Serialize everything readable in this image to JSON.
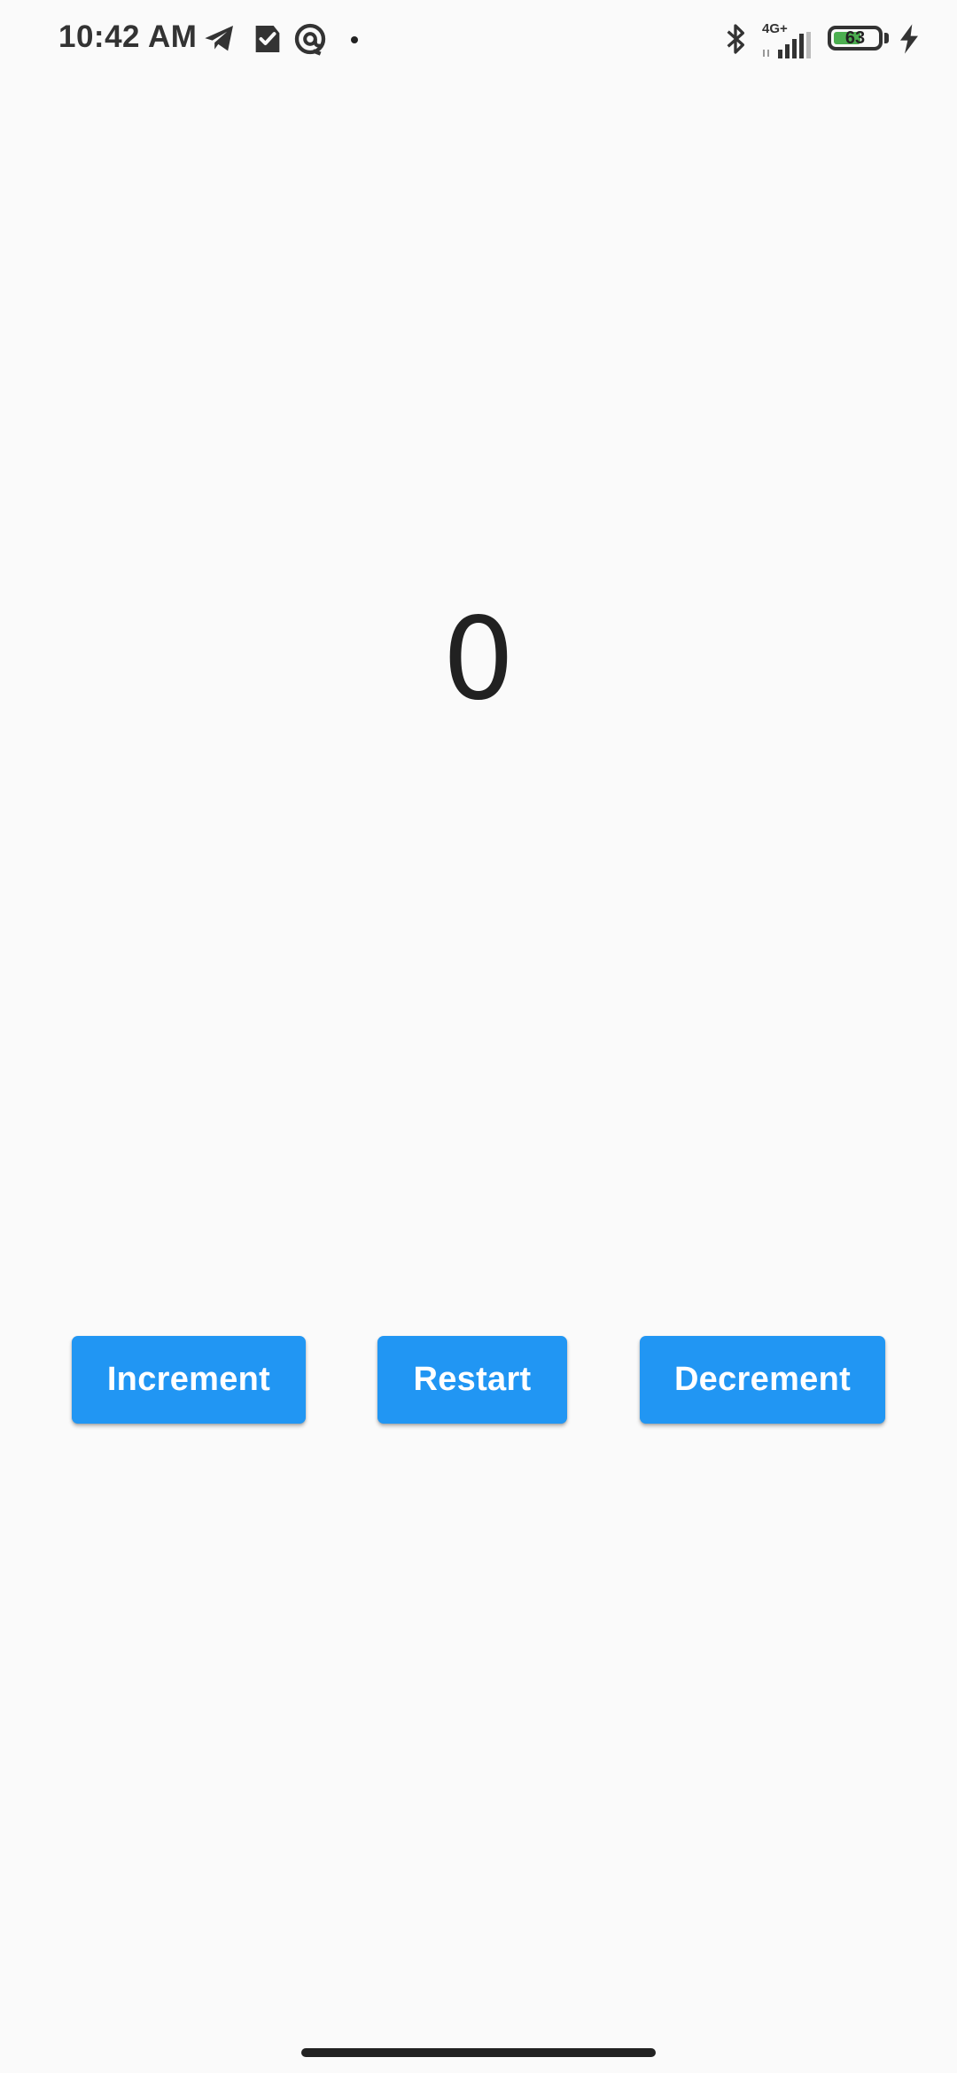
{
  "status_bar": {
    "time": "10:42 AM",
    "icons": [
      "telegram-icon",
      "task-check-icon",
      "at-sign-icon",
      "notification-dot"
    ],
    "right_icons": [
      "bluetooth-icon",
      "signal-icon",
      "battery-icon",
      "charging-icon"
    ],
    "network_type": "4G+",
    "battery_level": "63",
    "battery_fraction": 0.63,
    "battery_color": "#4caf50"
  },
  "counter": {
    "value": "0"
  },
  "buttons": {
    "increment_label": "Increment",
    "restart_label": "Restart",
    "decrement_label": "Decrement",
    "color": "#2196f3"
  }
}
